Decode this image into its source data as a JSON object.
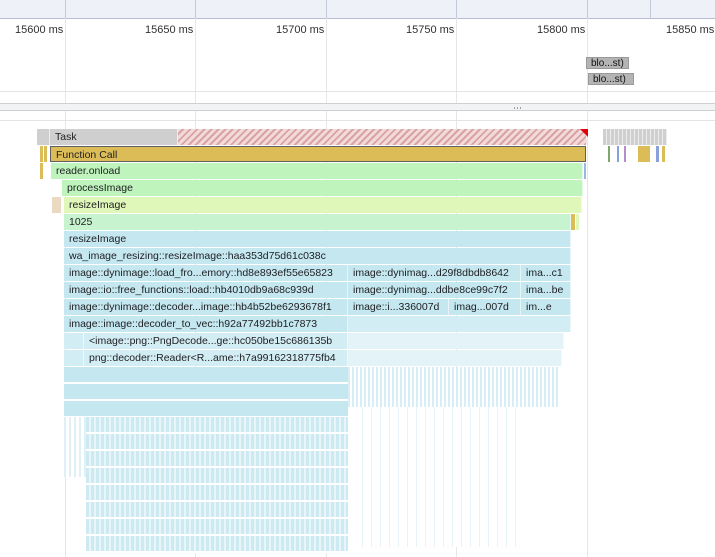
{
  "ruler": {
    "ticks": [
      "15600 ms",
      "15650 ms",
      "15700 ms",
      "15750 ms",
      "15800 ms",
      "15850 ms"
    ]
  },
  "network": {
    "items": [
      "blo...st)",
      "blo...st)"
    ]
  },
  "splitter": {
    "grip": "⋯"
  },
  "flame": {
    "task": "Task",
    "function_call": "Function Call",
    "reader_onload": "reader.onload",
    "process_image": "processImage",
    "resize_image_1": "resizeImage",
    "value_1025": "1025",
    "resize_image_2": "resizeImage",
    "wa_image_resizing": "wa_image_resizing::resizeImage::haa353d75d61c038c",
    "row7": [
      "image::dynimage::load_fro...emory::hd8e893ef55e65823",
      "image::dynimag...d29f8dbdb8642",
      "ima...c1"
    ],
    "row8": [
      "image::io::free_functions::load::hb4010db9a68c939d",
      "image::dynimag...ddbe8ce99c7f2",
      "ima...be"
    ],
    "row9": [
      "image::dynimage::decoder...image::hb4b52be6293678f1",
      "image::i...336007d",
      "imag...007d",
      "im...e"
    ],
    "row10": "image::image::decoder_to_vec::h92a77492bb1c7873",
    "row11": "<image::png::PngDecode...ge::hc050be15c686135b",
    "row12": "png::decoder::Reader<R...ame::h7a99162318775fb4"
  },
  "colors": {
    "task": "#cfcfcf",
    "function_call": "#dcbc57",
    "script_green": "#bff5bd",
    "script_lime": "#e0f7ba",
    "wasm_blue": "#c4e7f0",
    "long_task_marker": "#e0000b"
  }
}
